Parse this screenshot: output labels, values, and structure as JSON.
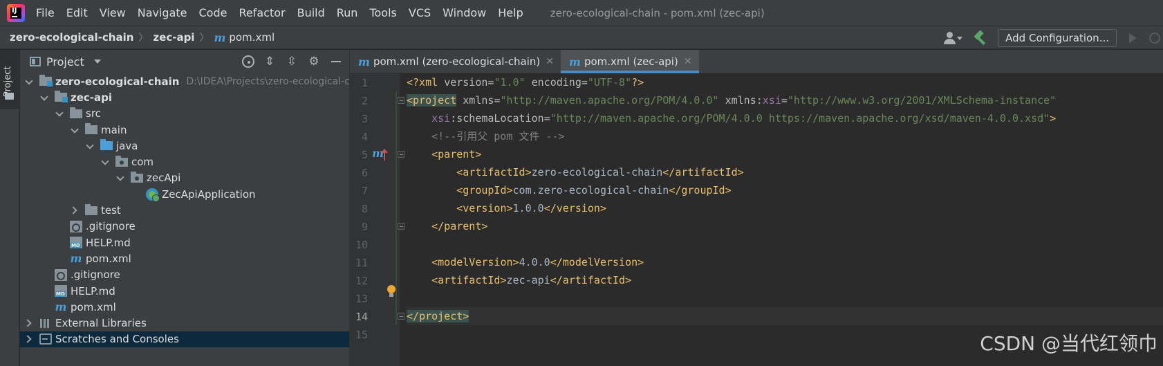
{
  "menubar": {
    "items": [
      "File",
      "Edit",
      "View",
      "Navigate",
      "Code",
      "Refactor",
      "Build",
      "Run",
      "Tools",
      "VCS",
      "Window",
      "Help"
    ],
    "window_title": "zero-ecological-chain - pom.xml (zec-api)"
  },
  "navbar": {
    "crumbs": [
      "zero-ecological-chain",
      "zec-api",
      "pom.xml"
    ],
    "add_configuration": "Add Configuration..."
  },
  "left_strip": {
    "tab_label": "Project"
  },
  "project_panel": {
    "title": "Project",
    "tree": [
      {
        "name": "zero-ecological-chain",
        "path": "D:\\IDEA\\Projects\\zero-ecological-cl",
        "bold": true
      },
      {
        "name": "zec-api",
        "bold": true
      },
      {
        "name": "src"
      },
      {
        "name": "main"
      },
      {
        "name": "java"
      },
      {
        "name": "com"
      },
      {
        "name": "zecApi"
      },
      {
        "name": "ZecApiApplication"
      },
      {
        "name": "test"
      },
      {
        "name": ".gitignore"
      },
      {
        "name": "HELP.md"
      },
      {
        "name": "pom.xml"
      },
      {
        "name": ".gitignore"
      },
      {
        "name": "HELP.md"
      },
      {
        "name": "pom.xml"
      },
      {
        "name": "External Libraries"
      },
      {
        "name": "Scratches and Consoles"
      }
    ]
  },
  "editor": {
    "tabs": [
      {
        "label": "pom.xml (zero-ecological-chain)",
        "active": false
      },
      {
        "label": "pom.xml (zec-api)",
        "active": true
      }
    ],
    "line_numbers": [
      "1",
      "2",
      "3",
      "4",
      "5",
      "6",
      "7",
      "8",
      "9",
      "10",
      "11",
      "12",
      "13",
      "14",
      "15"
    ],
    "gutter_mark": "m",
    "lines": {
      "l1": {
        "a": "<?xml ",
        "b": "version",
        "c": "=",
        "d": "\"1.0\"",
        "e": " encoding",
        "f": "=",
        "g": "\"UTF-8\"",
        "h": "?>"
      },
      "l2": {
        "a": "<",
        "b": "project",
        "c": " xmlns",
        "d": "=",
        "e": "\"http://maven.apache.org/POM/4.0.0\"",
        "f": " xmlns",
        "g": ":",
        "h": "xsi",
        "i": "=",
        "j": "\"http://www.w3.org/2001/XMLSchema-instance\""
      },
      "l3": {
        "a": "    ",
        "b": "xsi",
        "c": ":",
        "d": "schemaLocation",
        "e": "=",
        "f": "\"http://maven.apache.org/POM/4.0.0 https://maven.apache.org/xsd/maven-4.0.0.xsd\"",
        "g": ">"
      },
      "l4": {
        "a": "    <!--引用父 pom 文件 -->"
      },
      "l5": {
        "a": "    <parent>"
      },
      "l6": {
        "a": "        <artifactId>",
        "b": "zero-ecological-chain",
        "c": "</artifactId>"
      },
      "l7": {
        "a": "        <groupId>",
        "b": "com.zero-ecological-chain",
        "c": "</groupId>"
      },
      "l8": {
        "a": "        <version>",
        "b": "1.0.0",
        "c": "</version>"
      },
      "l9": {
        "a": "    </parent>"
      },
      "l11": {
        "a": "    <modelVersion>",
        "b": "4.0.0",
        "c": "</modelVersion>"
      },
      "l12": {
        "a": "    <artifactId>",
        "b": "zec-api",
        "c": "</artifactId>"
      },
      "l14": {
        "a": "</",
        "b": "project",
        "c": ">"
      }
    }
  },
  "watermark": "CSDN @当代红领巾"
}
